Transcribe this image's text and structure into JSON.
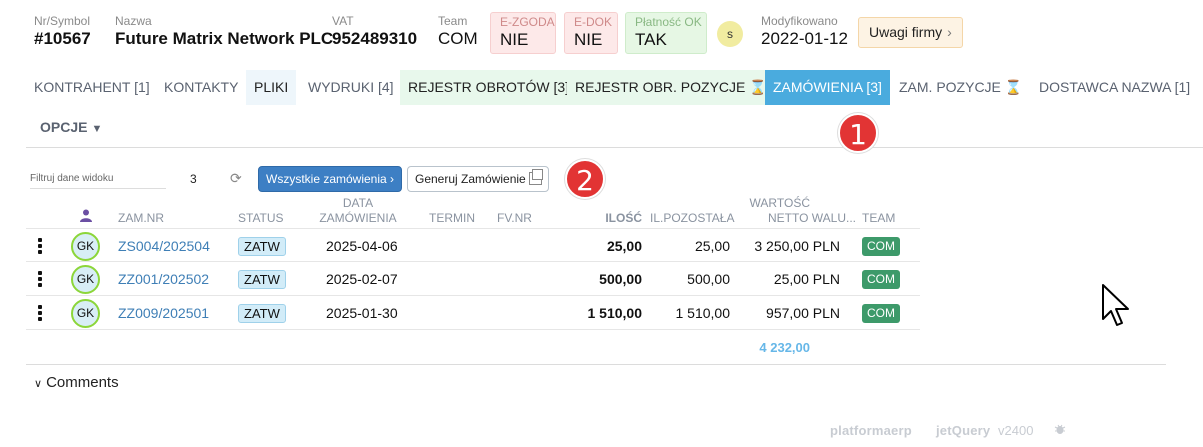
{
  "header": {
    "nr_label": "Nr/Symbol",
    "nr_value": "#10567",
    "name_label": "Nazwa",
    "name_value": "Future Matrix Network PLC",
    "vat_label": "VAT",
    "vat_value": "952489310",
    "team_label": "Team",
    "team_value": "COM",
    "ezgoda_label": "E-ZGODA",
    "ezgoda_value": "NIE",
    "edok_label": "E-DOK",
    "edok_value": "NIE",
    "platnosc_label": "Płatność OK",
    "platnosc_value": "TAK",
    "s_badge": "s",
    "modified_label": "Modyfikowano",
    "modified_value": "2022-01-12",
    "uwagi_label": "Uwagi firmy"
  },
  "tabs": [
    {
      "label": "KONTRAHENT [1]"
    },
    {
      "label": "KONTAKTY"
    },
    {
      "label": "PLIKI"
    },
    {
      "label": "WYDRUKI [4]"
    },
    {
      "label": "REJESTR OBROTÓW [3]"
    },
    {
      "label": "REJESTR OBR. POZYCJE"
    },
    {
      "label": "ZAMÓWIENIA [3]"
    },
    {
      "label": "ZAM. POZYCJE"
    },
    {
      "label": "DOSTAWCA NAZWA [1]"
    }
  ],
  "options_label": "OPCJE",
  "markers": [
    "1",
    "2"
  ],
  "toolbar": {
    "filter_placeholder": "Filtruj dane widoku",
    "count": "3",
    "all_orders_label": "Wszystkie zamówienia",
    "generate_label": "Generuj Zamówienie"
  },
  "table": {
    "headers": {
      "zam_nr": "ZAM.NR",
      "status": "STATUS",
      "data_line1": "DATA",
      "data_line2": "ZAMÓWIENIA",
      "termin": "TERMIN",
      "fv_nr": "FV.NR",
      "ilosc": "ILOŚĆ",
      "il_pozostala": "IL.POZOSTAŁA",
      "wartosc_line1": "WARTOŚĆ",
      "wartosc_line2": "NETTO WALU...",
      "team": "TEAM"
    },
    "rows": [
      {
        "avatar": "GK",
        "zam_nr": "ZS004/202504",
        "status": "ZATW",
        "data": "2025-04-06",
        "ilosc": "25,00",
        "pozostala": "25,00",
        "wartosc": "3 250,00 PLN",
        "team": "COM"
      },
      {
        "avatar": "GK",
        "zam_nr": "ZZ001/202502",
        "status": "ZATW",
        "data": "2025-02-07",
        "ilosc": "500,00",
        "pozostala": "500,00",
        "wartosc": "25,00 PLN",
        "team": "COM"
      },
      {
        "avatar": "GK",
        "zam_nr": "ZZ009/202501",
        "status": "ZATW",
        "data": "2025-01-30",
        "ilosc": "1 510,00",
        "pozostala": "1 510,00",
        "wartosc": "957,00 PLN",
        "team": "COM"
      }
    ],
    "total": "4 232,00"
  },
  "comments_label": "Comments",
  "footer": {
    "brand": "platformaerp",
    "jetquery": "jetQuery",
    "version": "v2400"
  },
  "colors": {
    "active_tab": "#4aabde",
    "primary_button": "#3d7fc4",
    "team_badge": "#3d9a6a",
    "marker": "#e23434",
    "total": "#66b7e8"
  }
}
